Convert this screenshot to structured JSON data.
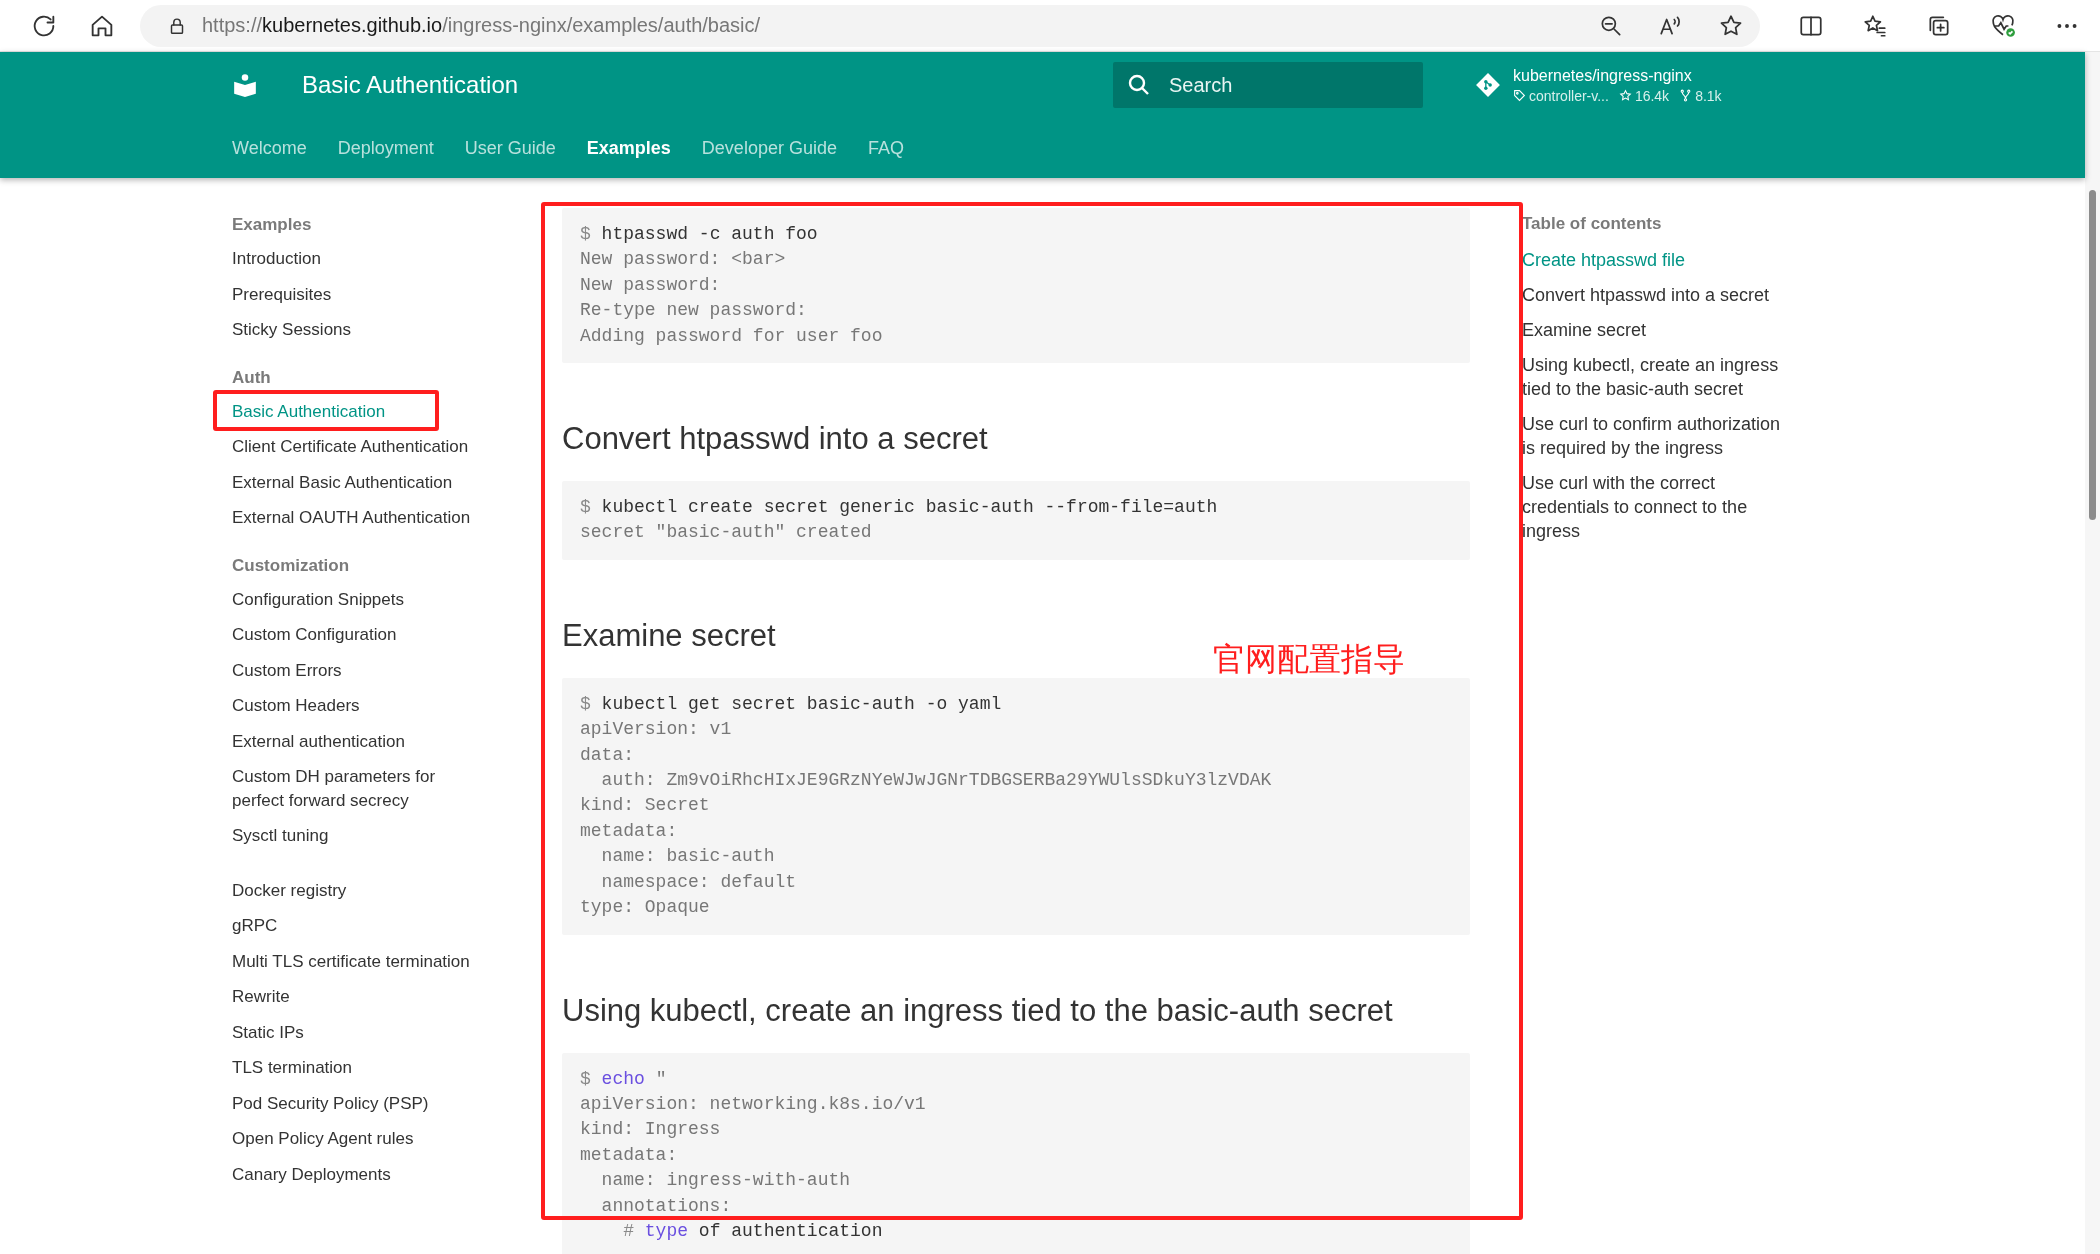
{
  "browser": {
    "url": {
      "scheme": "https://",
      "host": "kubernetes.github.io",
      "path": "/ingress-nginx/examples/auth/basic/"
    }
  },
  "header": {
    "title": "Basic Authentication",
    "search": {
      "placeholder": "Search"
    },
    "repo": {
      "name": "kubernetes/ingress-nginx",
      "version": "controller-v...",
      "star_count": "16.4k",
      "fork_count": "8.1k"
    }
  },
  "nav_tabs": [
    {
      "label": "Welcome",
      "selected": false
    },
    {
      "label": "Deployment",
      "selected": false
    },
    {
      "label": "User Guide",
      "selected": false
    },
    {
      "label": "Examples",
      "selected": true
    },
    {
      "label": "Developer Guide",
      "selected": false
    },
    {
      "label": "FAQ",
      "selected": false
    }
  ],
  "sidebar": {
    "groups": [
      {
        "title": "Examples",
        "items": [
          {
            "label": "Introduction",
            "selected": false
          },
          {
            "label": "Prerequisites",
            "selected": false
          },
          {
            "label": "Sticky Sessions",
            "selected": false
          }
        ]
      },
      {
        "title": "Auth",
        "items": [
          {
            "label": "Basic Authentication",
            "selected": true
          },
          {
            "label": "Client Certificate Authentication",
            "selected": false
          },
          {
            "label": "External Basic Authentication",
            "selected": false
          },
          {
            "label": "External OAUTH Authentication",
            "selected": false
          }
        ]
      },
      {
        "title": "Customization",
        "items": [
          {
            "label": "Configuration Snippets",
            "selected": false
          },
          {
            "label": "Custom Configuration",
            "selected": false
          },
          {
            "label": "Custom Errors",
            "selected": false
          },
          {
            "label": "Custom Headers",
            "selected": false
          },
          {
            "label": "External authentication",
            "selected": false
          },
          {
            "label": "Custom DH parameters for perfect forward secrecy",
            "selected": false
          },
          {
            "label": "Sysctl tuning",
            "selected": false
          }
        ]
      },
      {
        "items": [
          {
            "label": "Docker registry",
            "selected": false
          },
          {
            "label": "gRPC",
            "selected": false
          },
          {
            "label": "Multi TLS certificate termination",
            "selected": false
          },
          {
            "label": "Rewrite",
            "selected": false
          },
          {
            "label": "Static IPs",
            "selected": false
          },
          {
            "label": "TLS termination",
            "selected": false
          },
          {
            "label": "Pod Security Policy (PSP)",
            "selected": false
          },
          {
            "label": "Open Policy Agent rules",
            "selected": false
          },
          {
            "label": "Canary Deployments",
            "selected": false
          }
        ]
      }
    ]
  },
  "content": {
    "blocks": [
      {
        "kind": "code",
        "lines": [
          [
            {
              "kind": "prompt",
              "text": "$ "
            },
            {
              "kind": "command",
              "text": "htpasswd -c auth foo"
            }
          ],
          [
            {
              "kind": "output",
              "text": "New password: <bar>"
            }
          ],
          [
            {
              "kind": "output",
              "text": "New password:"
            }
          ],
          [
            {
              "kind": "output",
              "text": "Re-type new password:"
            }
          ],
          [
            {
              "kind": "output",
              "text": "Adding password for user foo"
            }
          ]
        ]
      },
      {
        "kind": "heading",
        "text": "Convert htpasswd into a secret"
      },
      {
        "kind": "code",
        "lines": [
          [
            {
              "kind": "prompt",
              "text": "$ "
            },
            {
              "kind": "command",
              "text": "kubectl create secret generic basic-auth --from-file=auth"
            }
          ],
          [
            {
              "kind": "output",
              "text": "secret \"basic-auth\" created"
            }
          ]
        ]
      },
      {
        "kind": "heading",
        "text": "Examine secret"
      },
      {
        "kind": "code",
        "lines": [
          [
            {
              "kind": "prompt",
              "text": "$ "
            },
            {
              "kind": "command",
              "text": "kubectl get secret basic-auth -o yaml"
            }
          ],
          [
            {
              "kind": "output",
              "text": "apiVersion: v1"
            }
          ],
          [
            {
              "kind": "output",
              "text": "data:"
            }
          ],
          [
            {
              "kind": "output",
              "text": "  auth: Zm9vOiRhcHIxJE9GRzNYeWJwJGNrTDBGSERBa29YWUlsSDkuY3lzVDAK"
            }
          ],
          [
            {
              "kind": "output",
              "text": "kind: Secret"
            }
          ],
          [
            {
              "kind": "output",
              "text": "metadata:"
            }
          ],
          [
            {
              "kind": "output",
              "text": "  name: basic-auth"
            }
          ],
          [
            {
              "kind": "output",
              "text": "  namespace: default"
            }
          ],
          [
            {
              "kind": "output",
              "text": "type: Opaque"
            }
          ]
        ]
      },
      {
        "kind": "heading",
        "text": "Using kubectl, create an ingress tied to the basic-auth secret"
      },
      {
        "kind": "code",
        "lines": [
          [
            {
              "kind": "prompt",
              "text": "$ "
            },
            {
              "kind": "keyword",
              "text": "echo"
            },
            {
              "kind": "output",
              "text": " \""
            }
          ],
          [
            {
              "kind": "output",
              "text": "apiVersion: networking.k8s.io/v1"
            }
          ],
          [
            {
              "kind": "output",
              "text": "kind: Ingress"
            }
          ],
          [
            {
              "kind": "output",
              "text": "metadata:"
            }
          ],
          [
            {
              "kind": "output",
              "text": "  name: ingress-with-auth"
            }
          ],
          [
            {
              "kind": "output",
              "text": "  annotations:"
            }
          ],
          [
            {
              "kind": "prompt",
              "text": "    # "
            },
            {
              "kind": "keyword",
              "text": "type"
            },
            {
              "kind": "command",
              "text": " of authentication"
            }
          ]
        ]
      }
    ]
  },
  "toc": {
    "title": "Table of contents",
    "items": [
      {
        "label": "Create htpasswd file",
        "selected": true
      },
      {
        "label": "Convert htpasswd into a secret",
        "selected": false
      },
      {
        "label": "Examine secret",
        "selected": false
      },
      {
        "label": "Using kubectl, create an ingress tied to the basic-auth secret",
        "selected": false
      },
      {
        "label": "Use curl to confirm authorization is required by the ingress",
        "selected": false
      },
      {
        "label": "Use curl with the correct credentials to connect to the ingress",
        "selected": false
      }
    ]
  },
  "annotation": {
    "note": "官网配置指导"
  }
}
